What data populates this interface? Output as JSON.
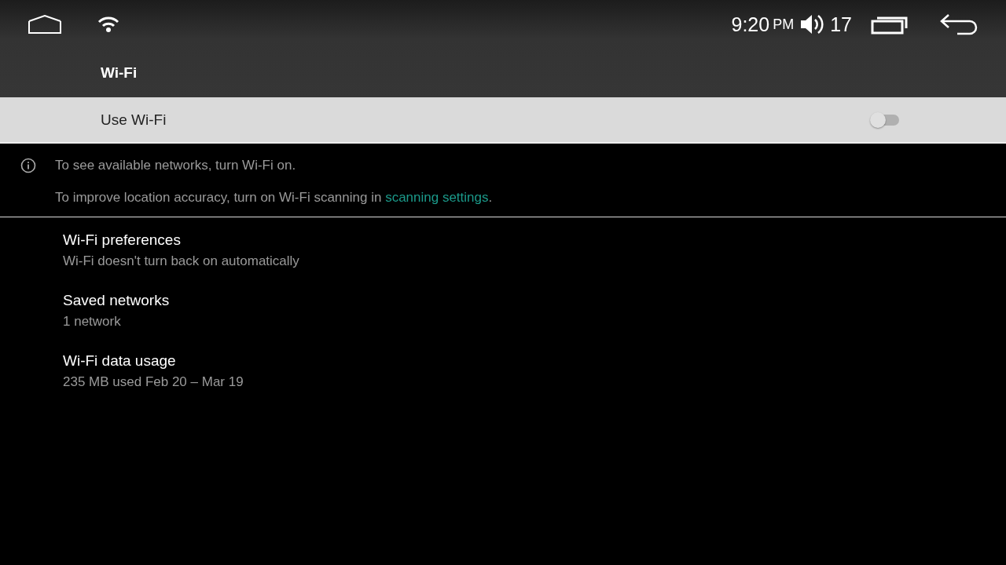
{
  "status_bar": {
    "time": "9:20",
    "meridiem": "PM",
    "volume": "17"
  },
  "toolbar": {
    "title": "Wi-Fi"
  },
  "master_switch": {
    "label": "Use Wi-Fi",
    "on": false
  },
  "info": {
    "message": "To see available networks, turn Wi-Fi on.",
    "scanning_note": {
      "text": "To improve location accuracy, turn on Wi-Fi scanning in ",
      "link": "scanning settings",
      "end": "."
    }
  },
  "preferences": [
    {
      "title": "Wi-Fi preferences",
      "summary": "Wi-Fi doesn't turn back on automatically"
    },
    {
      "title": "Saved networks",
      "summary": "1 network"
    },
    {
      "title": "Wi-Fi data usage",
      "summary": "235 MB used Feb 20 – Mar 19"
    }
  ]
}
